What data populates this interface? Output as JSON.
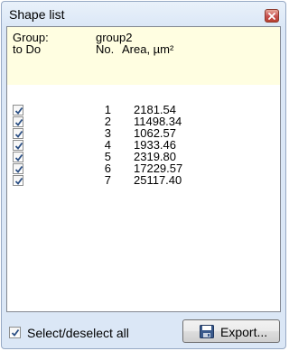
{
  "window": {
    "title": "Shape list"
  },
  "header": {
    "group_label": "Group:",
    "group_value": "group2",
    "col_todo": "to Do",
    "col_no": "No.",
    "col_area": "Area, µm²"
  },
  "rows": [
    {
      "checked": true,
      "no": "1",
      "area": "2181.54"
    },
    {
      "checked": true,
      "no": "2",
      "area": "11498.34"
    },
    {
      "checked": true,
      "no": "3",
      "area": "1062.57"
    },
    {
      "checked": true,
      "no": "4",
      "area": "1933.46"
    },
    {
      "checked": true,
      "no": "5",
      "area": "2319.80"
    },
    {
      "checked": true,
      "no": "6",
      "area": "17229.57"
    },
    {
      "checked": true,
      "no": "7",
      "area": "25117.40"
    }
  ],
  "footer": {
    "select_all_label": "Select/deselect all",
    "select_all_checked": true,
    "export_label": "Export..."
  },
  "icons": {
    "close": "close-icon",
    "export": "floppy-disk-icon",
    "check": "checkmark-icon"
  },
  "colors": {
    "header_background": "#fffee1",
    "check_color": "#2b4f84",
    "close_button": "#c75050"
  }
}
